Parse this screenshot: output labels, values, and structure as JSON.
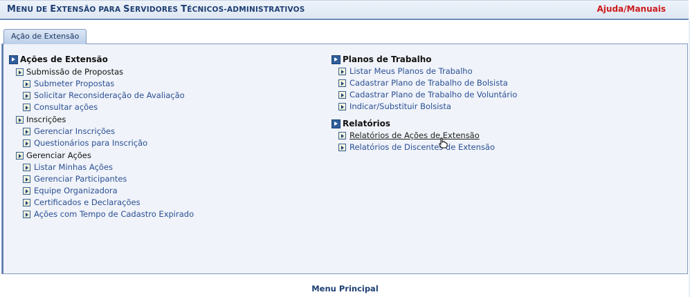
{
  "header": {
    "title_parts": [
      {
        "text": "M",
        "big": true
      },
      {
        "text": "ENU DE ",
        "big": false
      },
      {
        "text": "E",
        "big": true
      },
      {
        "text": "XTENSÃO PARA ",
        "big": false
      },
      {
        "text": "S",
        "big": true
      },
      {
        "text": "ERVIDORES ",
        "big": false
      },
      {
        "text": "T",
        "big": true
      },
      {
        "text": "ÉCNICOS-ADMINISTRATIVOS",
        "big": false
      }
    ],
    "help_link": "Ajuda/Manuais"
  },
  "tab": {
    "label": "Ação de Extensão"
  },
  "left": {
    "section_title": "Ações de Extensão",
    "groups": [
      {
        "label": "Submissão de Propostas",
        "items": [
          "Submeter Propostas",
          "Solicitar Reconsideração de Avaliação",
          "Consultar ações"
        ]
      },
      {
        "label": "Inscrições",
        "items": [
          "Gerenciar Inscrições",
          "Questionários para Inscrição"
        ]
      },
      {
        "label": "Gerenciar Ações",
        "items": [
          "Listar Minhas Ações",
          "Gerenciar Participantes",
          "Equipe Organizadora",
          "Certificados e Declarações",
          "Ações com Tempo de Cadastro Expirado"
        ]
      }
    ]
  },
  "right": {
    "planos": {
      "title": "Planos de Trabalho",
      "items": [
        "Listar Meus Planos de Trabalho",
        "Cadastrar Plano de Trabalho de Bolsista",
        "Cadastrar Plano de Trabalho de Voluntário",
        "Indicar/Substituir Bolsista"
      ]
    },
    "relatorios": {
      "title": "Relatórios",
      "items": [
        "Relatórios de Ações de Extensão",
        "Relatórios de Discentes de Extensão"
      ],
      "hovered_index": 0
    }
  },
  "footer": {
    "link": "Menu Principal"
  },
  "colors": {
    "title_blue": "#1e3f73",
    "help_red": "#cc1b1b",
    "link_blue": "#2a4f94",
    "panel_bg": "#f0f3f9"
  },
  "icons": {
    "section": "blue-square-arrow-icon",
    "item": "small-arrow-bullet-icon",
    "cursor": "hand-pointer-icon"
  }
}
